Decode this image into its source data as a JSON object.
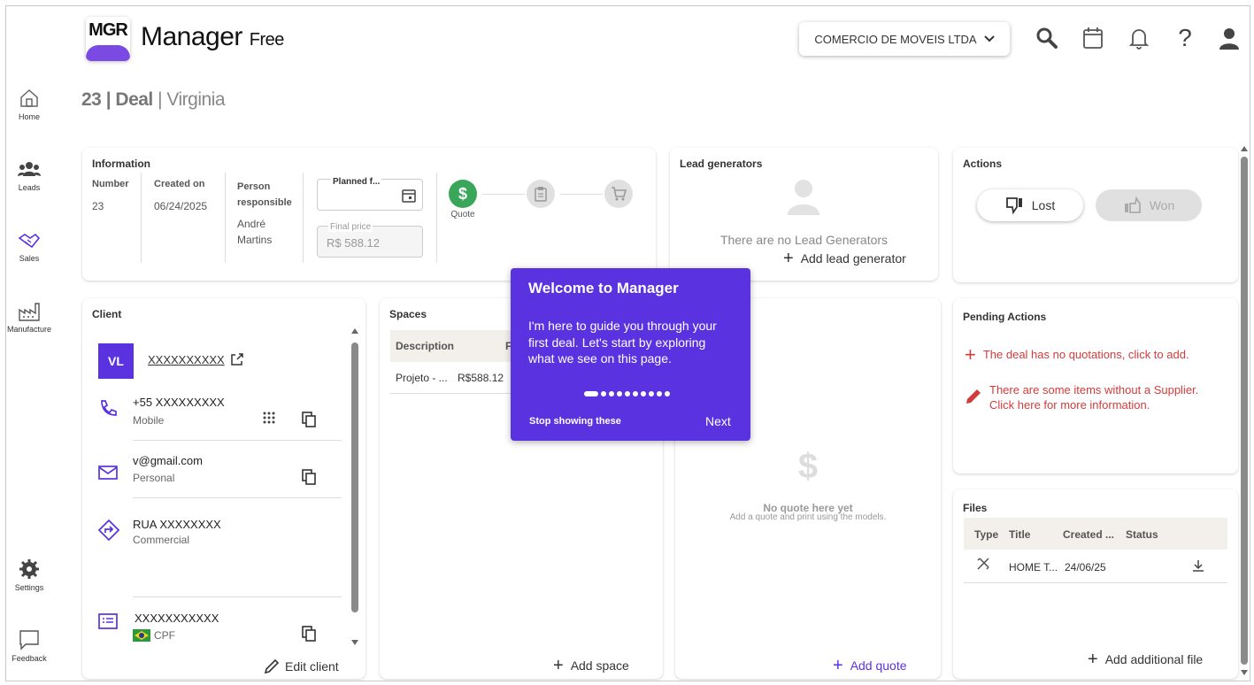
{
  "app": {
    "logo_text": "MGR",
    "title": "Manager",
    "title_suffix": "Free"
  },
  "header": {
    "company": "COMERCIO DE MOVEIS LTDA"
  },
  "nav": {
    "home": "Home",
    "leads": "Leads",
    "sales": "Sales",
    "manufacture": "Manufacture",
    "settings": "Settings",
    "feedback": "Feedback"
  },
  "breadcrumb": {
    "number": "23",
    "type": "Deal",
    "name": "Virginia"
  },
  "information": {
    "title": "Information",
    "number_label": "Number",
    "number_value": "23",
    "created_label": "Created on",
    "created_value": "06/24/2025",
    "person_label_1": "Person",
    "person_label_2": "responsible",
    "person_value_1": "André",
    "person_value_2": "Martins",
    "planned_label": "Planned f...",
    "final_price_label": "Final price",
    "final_price_value": "R$ 588.12",
    "step_label": "Quote"
  },
  "lead_generators": {
    "title": "Lead generators",
    "empty_text": "There are no Lead Generators",
    "add_label": "Add lead generator"
  },
  "actions": {
    "title": "Actions",
    "lost_label": "Lost",
    "won_label": "Won"
  },
  "client": {
    "title": "Client",
    "initials": "VL",
    "name": "XXXXXXXXXX",
    "phone": "+55 XXXXXXXXX",
    "phone_type": "Mobile",
    "email": "v@gmail.com",
    "email_type": "Personal",
    "address": "RUA XXXXXXXX",
    "address_type": "Commercial",
    "doc": "XXXXXXXXXXX",
    "doc_type": "CPF",
    "edit_label": "Edit client"
  },
  "spaces": {
    "title": "Spaces",
    "col_description": "Description",
    "col_f": "F",
    "row_desc": "Projeto - ...",
    "row_price": "R$588.12",
    "add_label": "Add space"
  },
  "quotes": {
    "empty_symbol": "$",
    "empty_title": "No quote here yet",
    "empty_sub": "Add a quote and print using the models.",
    "add_label": "Add quote"
  },
  "pending": {
    "title": "Pending Actions",
    "item1": "The deal has no quotations, click to add.",
    "item2_line1": "There are some items without a Supplier.",
    "item2_line2": "Click here for more information."
  },
  "files": {
    "title": "Files",
    "col_type": "Type",
    "col_title": "Title",
    "col_created": "Created ...",
    "col_status": "Status",
    "row_title": "HOME T...",
    "row_created": "24/06/25",
    "add_label": "Add additional file"
  },
  "tour": {
    "title": "Welcome to Manager",
    "body": "I'm here to guide you through your first deal. Let's start by exploring what we see on this page.",
    "stop_label": "Stop showing these",
    "next_label": "Next",
    "step_current": 1,
    "step_total": 10
  },
  "colors": {
    "accent": "#5b32e0",
    "success": "#3aa65a",
    "danger": "#d23c3c"
  }
}
